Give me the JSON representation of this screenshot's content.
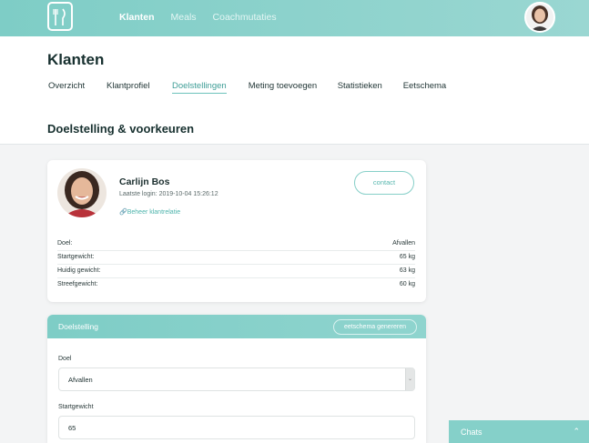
{
  "nav": {
    "items": [
      {
        "label": "Klanten",
        "active": true
      },
      {
        "label": "Meals",
        "active": false
      },
      {
        "label": "Coachmutaties",
        "active": false
      }
    ]
  },
  "page": {
    "title": "Klanten",
    "tabs": [
      {
        "label": "Overzicht",
        "active": false
      },
      {
        "label": "Klantprofiel",
        "active": false
      },
      {
        "label": "Doelstellingen",
        "active": true
      },
      {
        "label": "Meting toevoegen",
        "active": false
      },
      {
        "label": "Statistieken",
        "active": false
      },
      {
        "label": "Eetschema",
        "active": false
      }
    ],
    "section_title": "Doelstelling & voorkeuren"
  },
  "profile": {
    "name": "Carlijn Bos",
    "last_login": "Laatste login: 2019-10-04 15:26:12",
    "manage_link": "Beheer klantrelatie",
    "contact_label": "contact",
    "stats": [
      {
        "label": "Doel:",
        "value": "Afvallen"
      },
      {
        "label": "Startgewicht:",
        "value": "65 kg"
      },
      {
        "label": "Huidig gewicht:",
        "value": "63 kg"
      },
      {
        "label": "Streefgewicht:",
        "value": "60 kg"
      }
    ]
  },
  "goal": {
    "title": "Doelstelling",
    "generate_label": "eetschema genereren",
    "doel_label": "Doel",
    "doel_value": "Afvallen",
    "startgewicht_label": "Startgewicht",
    "startgewicht_value": "65"
  },
  "chats": {
    "label": "Chats"
  },
  "colors": {
    "accent": "#7ecdc6",
    "accent_dark": "#3f9e97",
    "text": "#17302f"
  },
  "icons": [
    "logo-icon",
    "avatar",
    "link-icon",
    "chevron-up-icon",
    "select-arrow-icon"
  ]
}
